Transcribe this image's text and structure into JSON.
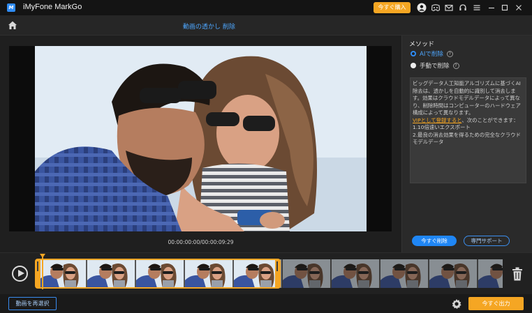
{
  "app": {
    "title": "iMyFone MarkGo",
    "logo_text": "M"
  },
  "titlebar": {
    "buy_label": "今すぐ購入",
    "icons": [
      "user-icon",
      "discord-icon",
      "mail-icon",
      "support-icon",
      "menu-icon",
      "minimize-icon",
      "maximize-icon",
      "close-icon"
    ]
  },
  "nav": {
    "page_title": "動画の透かし 削除"
  },
  "player": {
    "timecode": "00:00:00:00/00:00:09:29"
  },
  "panel": {
    "method_label": "メソッド",
    "option_ai": "AIで削除",
    "option_manual": "手動で削除",
    "desc_text": "ビッグデータ人工知能アルゴリズムに基づくAI除去は、透かしを自動的に識別して消去します。効果はクラウドモデルデータによって異なり、削除時間はコンピューターのハードウェア構成によって異なります。",
    "vip_link": "VIPとして登録すると",
    "desc_after_vip": "、次のことができます：",
    "benefit_1": "1.10倍速いエクスポート",
    "benefit_2": "2.最良の消去効果を得るための完全なクラウドモデルデータ",
    "remove_label": "今すぐ削除",
    "support_label": "専門サポート"
  },
  "bottom": {
    "reselect_label": "動画を再選択",
    "export_label": "今すぐ出力"
  },
  "colors": {
    "accent_orange": "#f5a623",
    "accent_blue": "#1f86f5",
    "link_blue": "#4ea7ff"
  }
}
